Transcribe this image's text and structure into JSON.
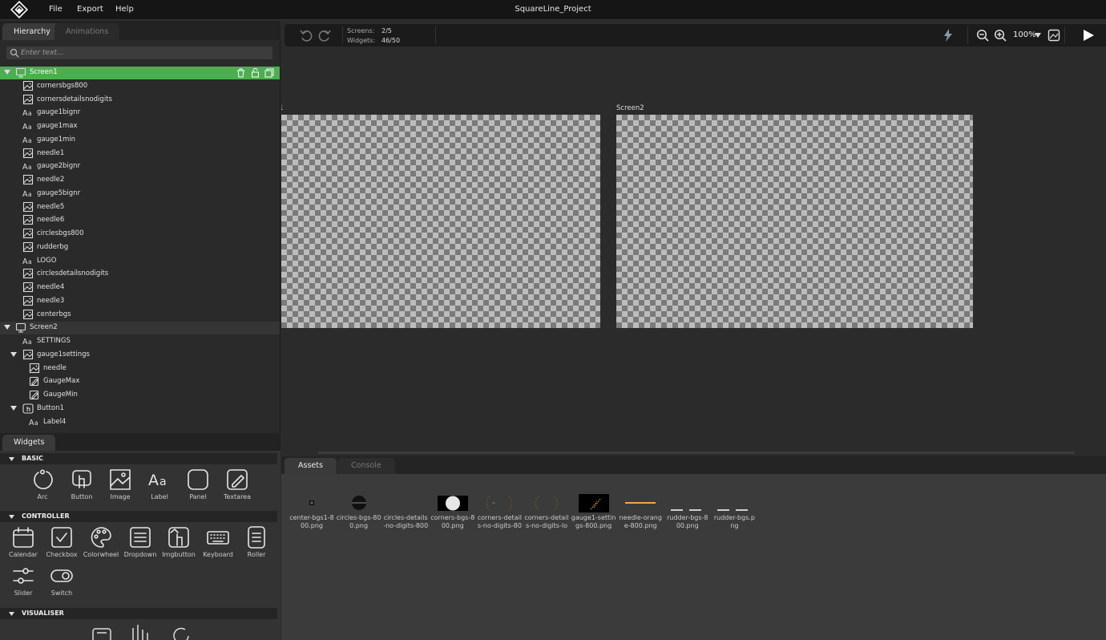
{
  "app": {
    "title": "SquareLine_Project",
    "menu": [
      "File",
      "Export",
      "Help"
    ]
  },
  "left": {
    "tabs": [
      "Hierarchy",
      "Animations"
    ],
    "search_placeholder": "Enter text...",
    "tree": [
      {
        "label": "Screen1",
        "icon": "screen-icon",
        "depth": 0,
        "expanded": true,
        "selected": true,
        "screen": true
      },
      {
        "label": "cornersbgs800",
        "icon": "image-icon",
        "depth": 1
      },
      {
        "label": "cornersdetailsnodigits",
        "icon": "image-icon",
        "depth": 1
      },
      {
        "label": "gauge1bignr",
        "icon": "label-icon",
        "depth": 1
      },
      {
        "label": "gauge1max",
        "icon": "label-icon",
        "depth": 1
      },
      {
        "label": "gauge1min",
        "icon": "label-icon",
        "depth": 1
      },
      {
        "label": "needle1",
        "icon": "image-icon",
        "depth": 1
      },
      {
        "label": "gauge2bignr",
        "icon": "label-icon",
        "depth": 1
      },
      {
        "label": "needle2",
        "icon": "image-icon",
        "depth": 1
      },
      {
        "label": "gauge5bignr",
        "icon": "label-icon",
        "depth": 1
      },
      {
        "label": "needle5",
        "icon": "image-icon",
        "depth": 1
      },
      {
        "label": "needle6",
        "icon": "image-icon",
        "depth": 1
      },
      {
        "label": "circlesbgs800",
        "icon": "image-icon",
        "depth": 1
      },
      {
        "label": "rudderbg",
        "icon": "image-icon",
        "depth": 1
      },
      {
        "label": "LOGO",
        "icon": "label-icon",
        "depth": 1
      },
      {
        "label": "circlesdetailsnodigits",
        "icon": "image-icon",
        "depth": 1
      },
      {
        "label": "needle4",
        "icon": "image-icon",
        "depth": 1
      },
      {
        "label": "needle3",
        "icon": "image-icon",
        "depth": 1
      },
      {
        "label": "centerbgs",
        "icon": "image-icon",
        "depth": 1
      },
      {
        "label": "Screen2",
        "icon": "screen-icon",
        "depth": 0,
        "expanded": true,
        "screen": true
      },
      {
        "label": "SETTINGS",
        "icon": "label-icon",
        "depth": 1
      },
      {
        "label": "gauge1settings",
        "icon": "image-icon",
        "depth": 1,
        "expanded": true
      },
      {
        "label": "needle",
        "icon": "image-icon",
        "depth": 2
      },
      {
        "label": "GaugeMax",
        "icon": "textarea-icon",
        "depth": 2
      },
      {
        "label": "GaugeMin",
        "icon": "textarea-icon",
        "depth": 2
      },
      {
        "label": "Button1",
        "icon": "button-icon",
        "depth": 1,
        "expanded": true
      },
      {
        "label": "Label4",
        "icon": "label-icon",
        "depth": 2
      }
    ],
    "widgets_tab": "Widgets",
    "sections": {
      "basic": {
        "title": "BASIC",
        "items": [
          "Arc",
          "Button",
          "Image",
          "Label",
          "Panel",
          "Textarea"
        ]
      },
      "controller": {
        "title": "CONTROLLER",
        "items": [
          "Calendar",
          "Checkbox",
          "Colorwheel",
          "Dropdown",
          "Imgbutton",
          "Keyboard",
          "Roller",
          "Slider",
          "Switch"
        ]
      },
      "visualiser": {
        "title": "VISUALISER"
      }
    }
  },
  "toolbar": {
    "screens_label": "Screens:",
    "screens_value": "2/5",
    "widgets_label": "Widgets:",
    "widgets_value": "46/50",
    "zoom": "100%"
  },
  "canvas": {
    "screens": [
      "1",
      "Screen2"
    ]
  },
  "assets": {
    "tabs": [
      "Assets",
      "Console"
    ],
    "items": [
      {
        "label": "center-bgs1-8\n00.png",
        "thumb": "dot"
      },
      {
        "label": "circles-bgs-80\n0.png",
        "thumb": "circle"
      },
      {
        "label": "circles-details\n-no-digits-800",
        "thumb": "none"
      },
      {
        "label": "corners-bgs-8\n00.png",
        "thumb": "corners"
      },
      {
        "label": "corners-detail\ns-no-digits-80",
        "thumb": "details"
      },
      {
        "label": "corners-detail\ns-no-digits-lo",
        "thumb": "details2"
      },
      {
        "label": "gauge1-settin\ngs-800.png",
        "thumb": "gauge"
      },
      {
        "label": "needle-orang\ne-800.png",
        "thumb": "needle"
      },
      {
        "label": "rudder-bgs-8\n00.png",
        "thumb": "rudder"
      },
      {
        "label": "rudder-bgs.p\nng",
        "thumb": "rudder"
      }
    ]
  },
  "colors": {
    "accent": "#4cae4f",
    "play": "#ffffff"
  }
}
